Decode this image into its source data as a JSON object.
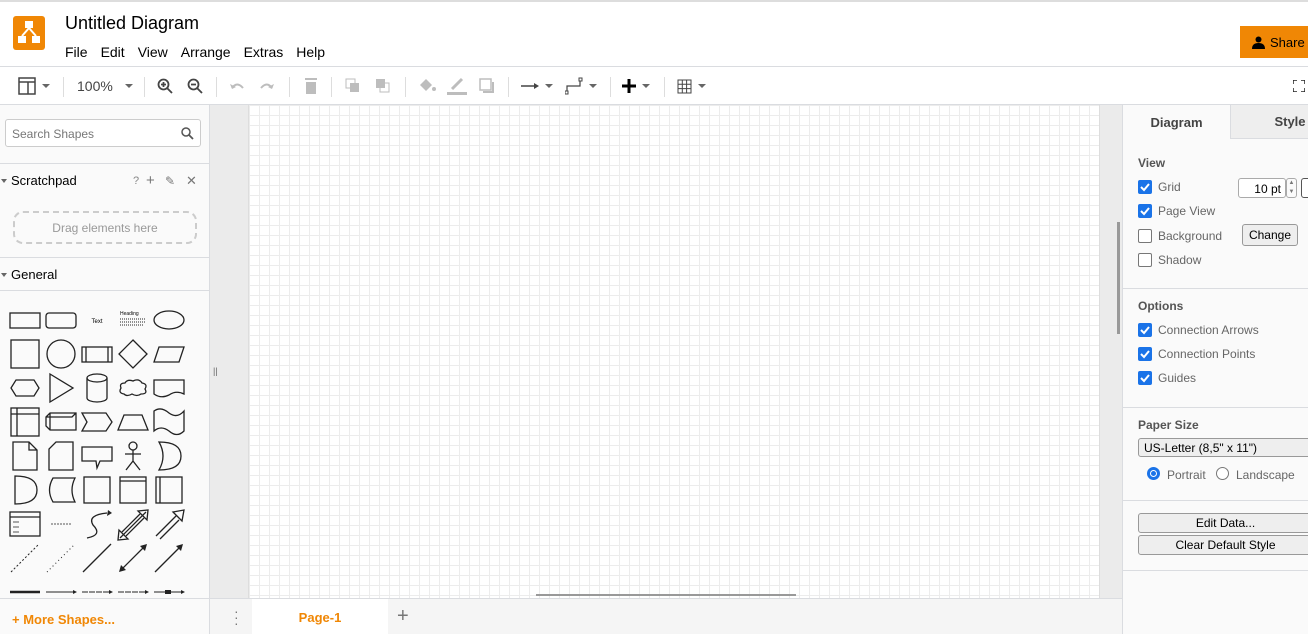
{
  "app": {
    "title": "Untitled Diagram",
    "menu": [
      "File",
      "Edit",
      "View",
      "Arrange",
      "Extras",
      "Help"
    ],
    "share_label": "Share",
    "accent": "#f08705"
  },
  "toolbar": {
    "zoom": "100%",
    "icons": [
      "format-panel-icon",
      "zoom-in-icon",
      "zoom-out-icon",
      "undo-icon",
      "redo-icon",
      "delete-icon",
      "to-front-icon",
      "to-back-icon",
      "fill-color-icon",
      "line-color-icon",
      "shadow-icon",
      "connection-icon",
      "waypoints-icon",
      "insert-icon",
      "table-icon",
      "fullscreen-icon"
    ]
  },
  "sidebar": {
    "search_placeholder": "Search Shapes",
    "scratchpad": {
      "title": "Scratchpad",
      "help": "?",
      "drag_hint": "Drag elements here"
    },
    "general_title": "General",
    "more_shapes": "More Shapes...",
    "shapes": [
      "rectangle",
      "rounded-rectangle",
      "text",
      "textbox",
      "ellipse",
      "square",
      "circle",
      "process",
      "diamond",
      "parallelogram",
      "hexagon",
      "triangle",
      "cylinder",
      "cloud",
      "document",
      "internal-storage",
      "cube",
      "step",
      "trapezoid",
      "tape",
      "note",
      "card",
      "callout",
      "actor",
      "or",
      "and",
      "data-storage",
      "container",
      "container-header",
      "container-vertical",
      "list",
      "list-item",
      "curve",
      "bidirectional-arrow",
      "arrow",
      "dashed-line",
      "dotted-line",
      "line",
      "bidirectional-connector",
      "directional-connector",
      "link",
      "connector-label",
      "connector-2-labels",
      "connector-3-labels",
      "connector-symbol"
    ]
  },
  "page_tab": {
    "label": "Page-1"
  },
  "format_panel": {
    "tabs": [
      "Diagram",
      "Style"
    ],
    "view": {
      "title": "View",
      "items": [
        {
          "label": "Grid",
          "checked": true
        },
        {
          "label": "Page View",
          "checked": true
        },
        {
          "label": "Background",
          "checked": false
        },
        {
          "label": "Shadow",
          "checked": false
        }
      ],
      "grid_size": "10 pt",
      "change_label": "Change"
    },
    "options": {
      "title": "Options",
      "items": [
        {
          "label": "Connection Arrows",
          "checked": true
        },
        {
          "label": "Connection Points",
          "checked": true
        },
        {
          "label": "Guides",
          "checked": true
        }
      ]
    },
    "paper": {
      "title": "Paper Size",
      "value": "US-Letter (8,5\" x 11\")",
      "orientation": [
        "Portrait",
        "Landscape"
      ],
      "selected": "Portrait"
    },
    "edit_data_label": "Edit Data...",
    "clear_style_label": "Clear Default Style"
  }
}
